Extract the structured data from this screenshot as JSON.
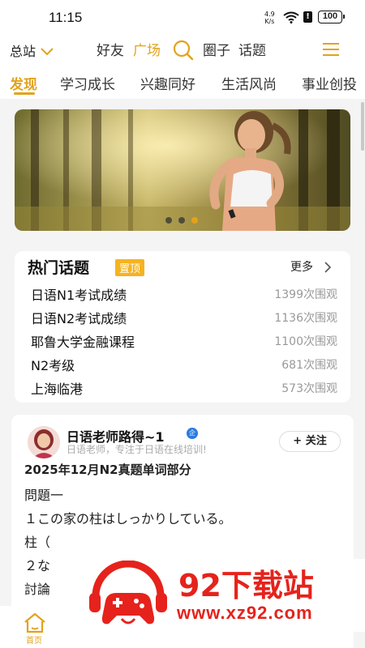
{
  "status_bar": {
    "time": "11:15",
    "net_speed_value": "4.9",
    "net_speed_unit": "K/s",
    "battery": "100"
  },
  "top_bar": {
    "site_label": "总站",
    "nav": [
      {
        "label": "好友",
        "active": false
      },
      {
        "label": "广场",
        "active": true
      },
      {
        "label": "圈子",
        "active": false
      },
      {
        "label": "话题",
        "active": false
      }
    ]
  },
  "tabs": [
    {
      "label": "发现",
      "active": true
    },
    {
      "label": "学习成长",
      "active": false
    },
    {
      "label": "兴趣同好",
      "active": false
    },
    {
      "label": "生活风尚",
      "active": false
    },
    {
      "label": "事业创投",
      "active": false
    }
  ],
  "banner": {
    "dot_count": 3,
    "active_dot": 2
  },
  "hot_topics": {
    "title": "热门话题",
    "pin_label": "置顶",
    "more_label": "更多",
    "items": [
      {
        "name": "日语N1考试成绩",
        "views": "1399次围观"
      },
      {
        "name": "日语N2考试成绩",
        "views": "1136次围观"
      },
      {
        "name": "耶鲁大学金融课程",
        "views": "1100次围观"
      },
      {
        "name": "N2考级",
        "views": "681次围观"
      },
      {
        "name": "上海临港",
        "views": "573次围观"
      }
    ]
  },
  "post": {
    "author": "日语老师路得~1",
    "verified_badge": "企",
    "bio": "日语老师，专注于日语在线培训!",
    "follow_label": "+ 关注",
    "title": "2025年12月N2真题单词部分",
    "lines": [
      "問題一",
      "１この家の柱はしっかりしている。",
      "柱（",
      "２な",
      "討論"
    ]
  },
  "watermark": {
    "title": "92下载站",
    "url": "www.xz92.com"
  },
  "bottom_nav": {
    "home_label": "首页"
  },
  "colors": {
    "accent": "#e4a21b",
    "pin": "#f6b320",
    "watermark": "#e5231c"
  }
}
